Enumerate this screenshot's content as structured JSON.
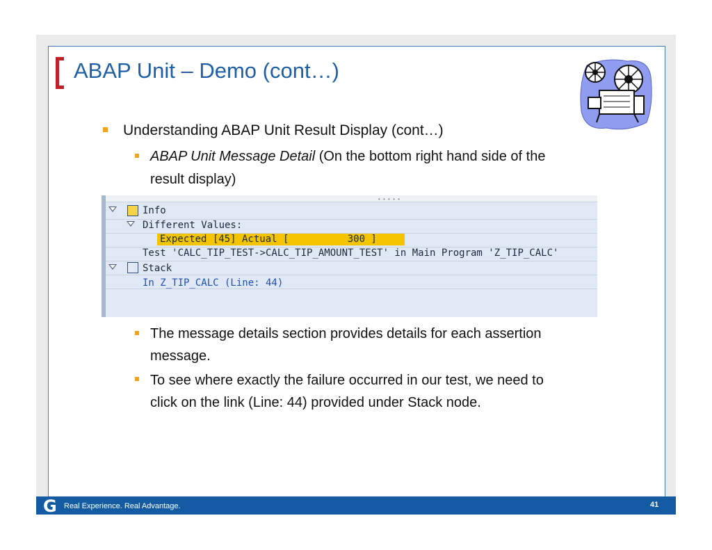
{
  "slide": {
    "title": "ABAP Unit – Demo (cont…)",
    "bullet1": "Understanding ABAP Unit Result Display (cont…)",
    "bullet2_em": "ABAP Unit Message Detail",
    "bullet2_rest": " (On the bottom right hand side of the",
    "bullet2_line2": "result display)",
    "bullet3_line1": "The message details section provides details for each assertion",
    "bullet3_line2": "message.",
    "bullet4_line1": "To see where exactly the failure occurred in our test, we need to",
    "bullet4_line2": "click on the link (Line: 44) provided under Stack node."
  },
  "sap": {
    "info_label": "Info",
    "diff_label": "Different Values:",
    "expected_line": "Expected [45] Actual [          300 ]",
    "test_line": "Test 'CALC_TIP_TEST->CALC_TIP_AMOUNT_TEST' in Main Program 'Z_TIP_CALC'",
    "stack_label": "Stack",
    "stack_link": "In Z_TIP_CALC (Line: 44)"
  },
  "footer": {
    "logo_letter": "G",
    "tagline": "Real Experience. Real Advantage.",
    "page_number": "41"
  },
  "colors": {
    "title": "#1f5fa8",
    "bracket": "#c0202a",
    "bullet": "#f2a21b",
    "footer": "#145ba3",
    "highlight": "#f5c400"
  },
  "icons": [
    "projector-clipart-icon",
    "info-node-icon",
    "stack-node-icon",
    "expand-triangle-icon"
  ]
}
